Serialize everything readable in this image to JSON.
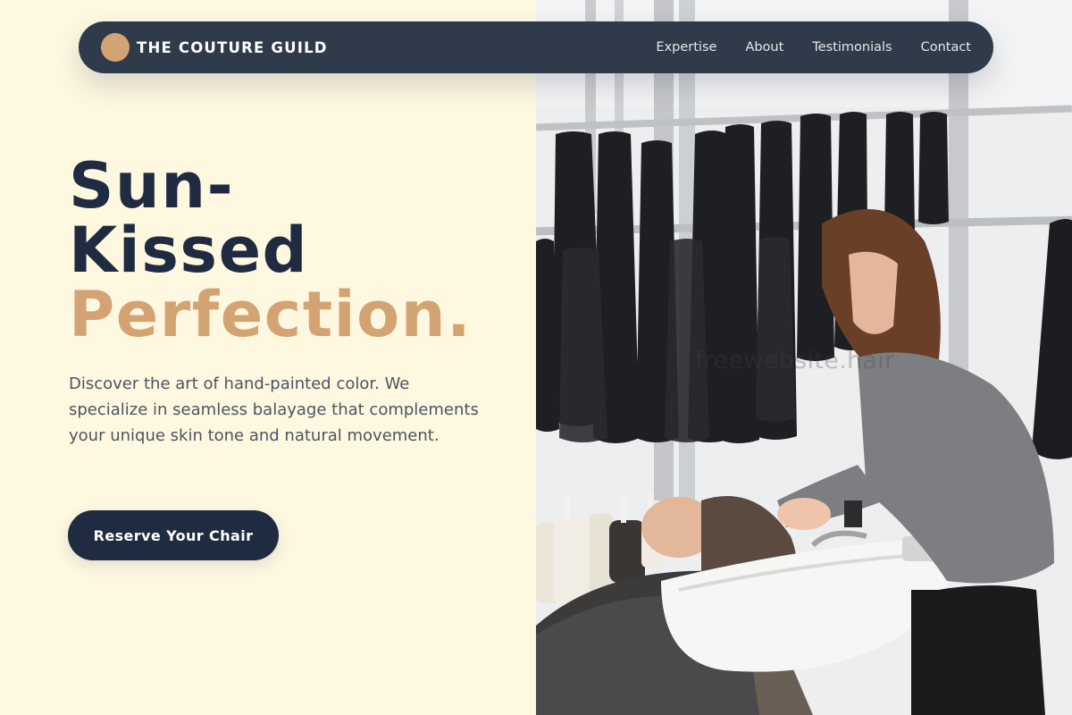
{
  "brand": {
    "name": "THE COUTURE GUILD",
    "accent_color": "#d4a373"
  },
  "nav": {
    "links": [
      {
        "label": "Expertise"
      },
      {
        "label": "About"
      },
      {
        "label": "Testimonials"
      },
      {
        "label": "Contact"
      }
    ]
  },
  "hero": {
    "headline_line1": "Sun-",
    "headline_line2": "Kissed",
    "headline_accent": "Perfection.",
    "description": "Discover the art of hand-painted color. We specialize in seamless balayage that complements your unique skin tone and natural movement.",
    "cta_label": "Reserve Your Chair"
  },
  "image": {
    "alt": "Stylist washing a smiling client's hair at a salon shampoo basin",
    "watermark": "freewebsite.hair"
  },
  "colors": {
    "background": "#fef8e1",
    "navy": "#1f2b40",
    "nav_bg": "#2f3a4b",
    "accent": "#d4a373",
    "body_text": "#4d5462"
  }
}
